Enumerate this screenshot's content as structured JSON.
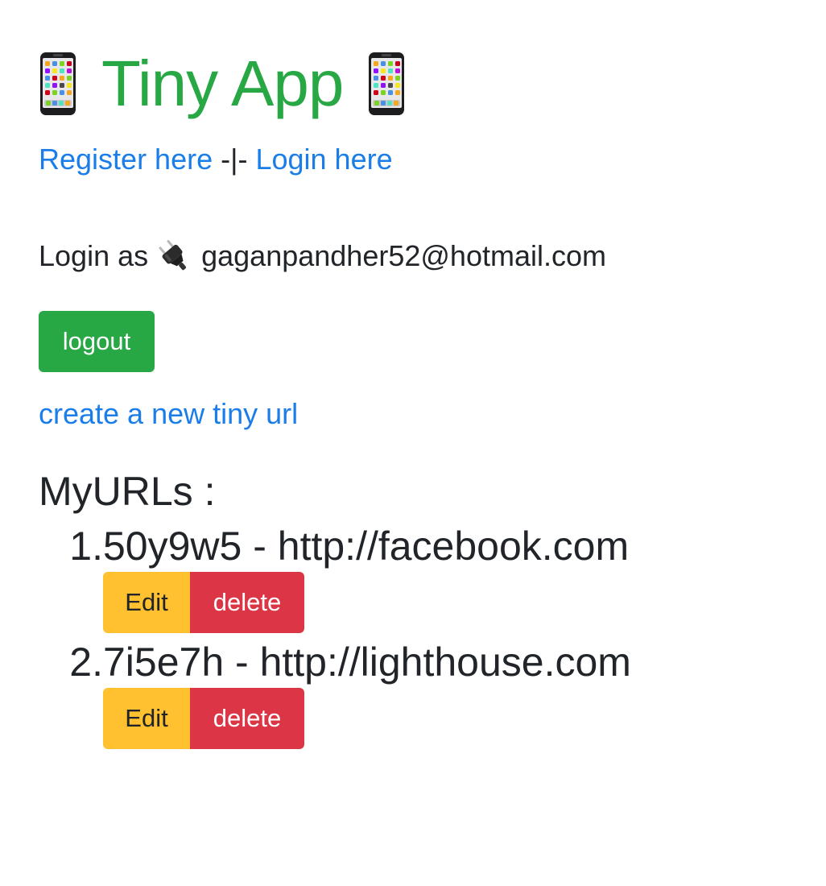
{
  "header": {
    "title": "Tiny App",
    "left_icon": "mobile-phone-icon",
    "right_icon": "mobile-phone-icon",
    "title_color": "#28a745"
  },
  "auth": {
    "register_label": "Register here",
    "separator": "-|-",
    "login_label": "Login here"
  },
  "session": {
    "prefix": "Login as",
    "icon": "plug-icon",
    "email": "gaganpandher52@hotmail.com",
    "logout_label": "logout"
  },
  "create_link_label": "create a new tiny url",
  "myurls": {
    "heading": "MyURLs :",
    "items": [
      {
        "number": "1.",
        "text": "50y9w5 - http://facebook.com",
        "edit_label": "Edit",
        "delete_label": "delete"
      },
      {
        "number": "2.",
        "text": "7i5e7h - http://lighthouse.com",
        "edit_label": "Edit",
        "delete_label": "delete"
      }
    ]
  },
  "colors": {
    "link": "#1a7de8",
    "success": "#28a745",
    "warning": "#ffc12f",
    "danger": "#dc3545",
    "text": "#212529"
  }
}
